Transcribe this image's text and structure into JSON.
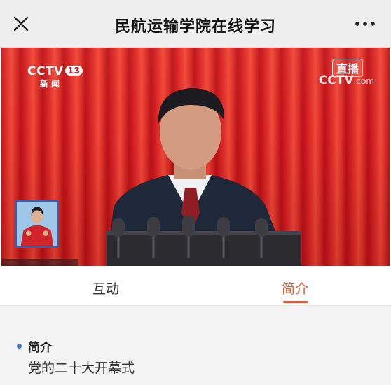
{
  "header": {
    "title": "民航运输学院在线学习",
    "close_icon": "close-icon",
    "more_icon": "more-dots-icon"
  },
  "video": {
    "channel_logo": "CCTV",
    "channel_number": "13",
    "channel_sub": "新闻",
    "live_label": "直播",
    "watermark": "CCTV",
    "watermark_suffix": ".com"
  },
  "tabs": [
    {
      "label": "互动",
      "active": false
    },
    {
      "label": "简介",
      "active": true
    }
  ],
  "intro": {
    "heading": "简介",
    "text": "党的二十大开幕式"
  },
  "colors": {
    "accent": "#d9603c",
    "bullet": "#3f6fd6",
    "curtain": "#d42a25",
    "nav_bg": "#eeeeee"
  }
}
